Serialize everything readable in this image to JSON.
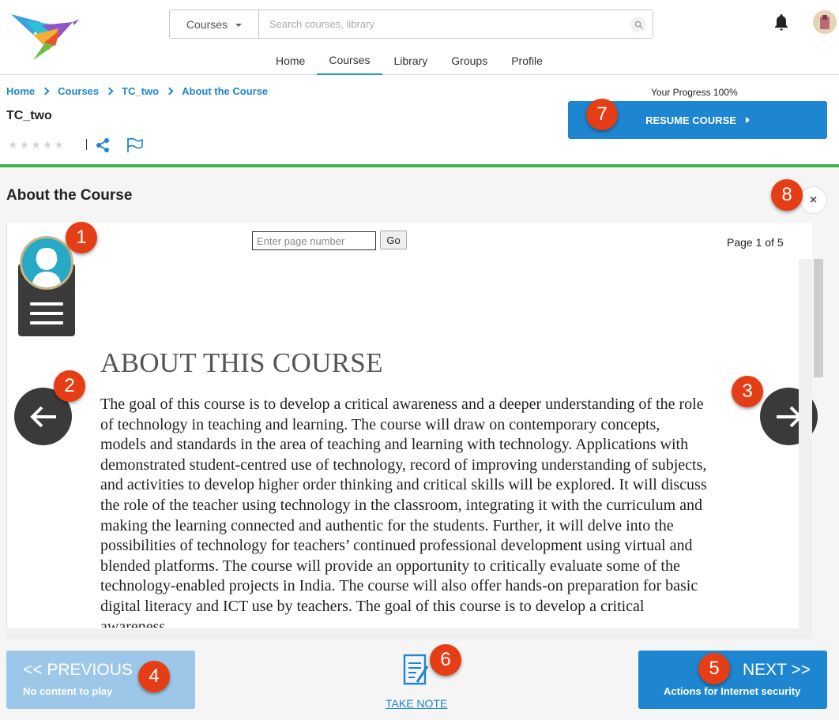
{
  "header": {
    "search": {
      "category": "Courses",
      "placeholder": "Search courses, library"
    },
    "nav": [
      {
        "label": "Home"
      },
      {
        "label": "Courses",
        "active": true
      },
      {
        "label": "Library"
      },
      {
        "label": "Groups"
      },
      {
        "label": "Profile"
      }
    ],
    "icons": [
      "logo-bird",
      "search-icon",
      "bell-icon",
      "user-avatar"
    ]
  },
  "breadcrumb": [
    "Home",
    "Courses",
    "TC_two",
    "About the Course"
  ],
  "course": {
    "title": "TC_two",
    "rating_stars": 0,
    "progress_text": "Your Progress 100%",
    "resume_label": "RESUME COURSE"
  },
  "section": {
    "title": "About the Course",
    "close_symbol": "×"
  },
  "viewer": {
    "page_input_placeholder": "Enter page number",
    "go_label": "Go",
    "page_info": "Page 1 of 5",
    "heading": "ABOUT THIS COURSE",
    "body": "The goal of this course is to develop a critical awareness and a deeper understanding of the role of technology in teaching and learning. The course will draw on contemporary concepts, models and standards in the area of teaching and learning with technology. Applications with demonstrated student-centred use of technology, record of improving understanding of subjects, and activities to develop higher order thinking and critical skills will be explored. It will discuss the role of the teacher using technology in the classroom, integrating it with the curriculum and making the learning connected and authentic for the students. Further, it will delve into the possibilities of technology for teachers’ continued professional development using virtual and blended platforms. The course will provide an opportunity to critically evaluate some of the technology-enabled projects in India. The course will also offer hands-on preparation for basic digital literacy and ICT use by teachers. The goal of this course is to develop a critical awareness"
  },
  "footer": {
    "prev_label": "<< PREVIOUS",
    "prev_sub": "No content to play",
    "note_label": "TAKE NOTE",
    "next_label": "NEXT >>",
    "next_sub": "Actions for Internet security"
  },
  "badges": [
    "1",
    "2",
    "3",
    "4",
    "5",
    "6",
    "7",
    "8"
  ],
  "colors": {
    "accent": "#1e86d0",
    "progress": "#3fb34f",
    "badge": "#e53d15",
    "prev_disabled": "#9dc7e8"
  }
}
